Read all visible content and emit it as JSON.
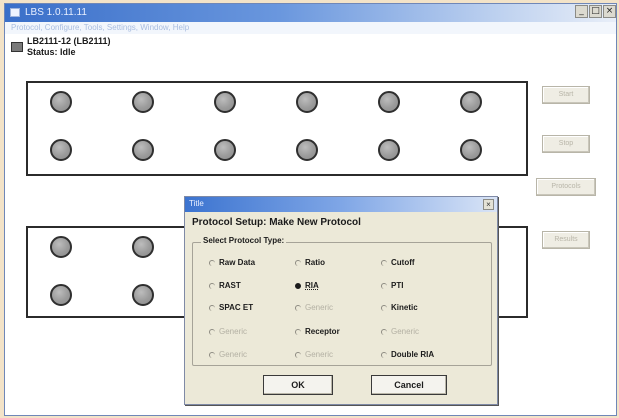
{
  "window": {
    "title": "LBS 1.0.11.11",
    "menu_path": "Protocol, Configure, Tools, Settings, Window, Help",
    "minimize_glyph": "_",
    "maximize_glyph": "□",
    "close_glyph": "×",
    "icon": "app-window-icon"
  },
  "device": {
    "id_label": "LB2111-12 (LB2111)",
    "status_label": "Status: Idle",
    "icon": "instrument-icon"
  },
  "plates": {
    "top_rows": 2,
    "bottom_rows": 2,
    "columns": 6,
    "well_color": "#9b9b9b"
  },
  "side_buttons": [
    "Start",
    "Stop",
    "Protocols",
    "Results"
  ],
  "dialog": {
    "title": "Title",
    "close_glyph": "×",
    "heading": "Protocol Setup: Make New Protocol",
    "group_label": "Select Protocol Type:",
    "options": [
      {
        "label": "Raw Data",
        "enabled": true,
        "checked": false
      },
      {
        "label": "Ratio",
        "enabled": true,
        "checked": false
      },
      {
        "label": "Cutoff",
        "enabled": true,
        "checked": false
      },
      {
        "label": "RAST",
        "enabled": true,
        "checked": false
      },
      {
        "label": "RIA",
        "enabled": true,
        "checked": true
      },
      {
        "label": "PTI",
        "enabled": true,
        "checked": false
      },
      {
        "label": "SPAC ET",
        "enabled": true,
        "checked": false
      },
      {
        "label": "Generic",
        "enabled": false,
        "checked": false
      },
      {
        "label": "Kinetic",
        "enabled": true,
        "checked": false
      },
      {
        "label": "Generic",
        "enabled": false,
        "checked": false
      },
      {
        "label": "Receptor",
        "enabled": true,
        "checked": false
      },
      {
        "label": "Generic",
        "enabled": false,
        "checked": false
      },
      {
        "label": "Generic",
        "enabled": false,
        "checked": false
      },
      {
        "label": "Generic",
        "enabled": false,
        "checked": false
      },
      {
        "label": "Double RIA",
        "enabled": true,
        "checked": false
      }
    ],
    "ok_label": "OK",
    "cancel_label": "Cancel"
  },
  "colors": {
    "title_blue": "#3a6fc9",
    "dialog_bg": "#ece9d8",
    "well_border": "#2f2f2f"
  }
}
